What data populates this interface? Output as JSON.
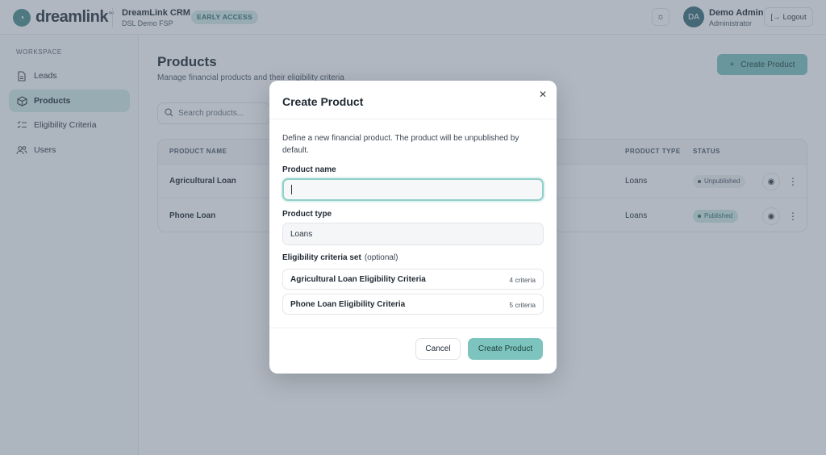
{
  "header": {
    "logo_text": "dreamlink",
    "logo_tm": "™",
    "app_name": "DreamLink CRM",
    "app_sub": "DSL Demo FSP",
    "badge": "EARLY ACCESS",
    "user_initials": "DA",
    "user_name": "Demo Admin",
    "user_role": "Administrator",
    "logout_label": "Logout"
  },
  "sidebar": {
    "section_label": "WORKSPACE",
    "items": [
      {
        "label": "Leads",
        "icon": "file-text-icon"
      },
      {
        "label": "Products",
        "icon": "box-icon",
        "active": true
      },
      {
        "label": "Eligibility Criteria",
        "icon": "checklist-icon"
      },
      {
        "label": "Users",
        "icon": "users-icon"
      }
    ]
  },
  "main": {
    "title": "Products",
    "subtitle": "Manage financial products and their eligibility criteria",
    "create_button": "Create Product",
    "search_placeholder": "Search products...",
    "columns": [
      "PRODUCT NAME",
      "PRODUCT TYPE",
      "STATUS"
    ],
    "rows": [
      {
        "name": "Agricultural Loan",
        "type": "Loans",
        "status": "Unpublished"
      },
      {
        "name": "Phone Loan",
        "type": "Loans",
        "status": "Published"
      }
    ]
  },
  "modal": {
    "title": "Create Product",
    "description": "Define a new financial product. The product will be unpublished by default.",
    "name_label": "Product name",
    "name_value": "",
    "type_label": "Product type",
    "type_value": "Loans",
    "criteria_label": "Eligibility criteria set",
    "criteria_optional": "(optional)",
    "criteria": [
      {
        "name": "Agricultural Loan Eligibility Criteria",
        "count": "4 criteria"
      },
      {
        "name": "Phone Loan Eligibility Criteria",
        "count": "5 criteria"
      }
    ],
    "cancel_label": "Cancel",
    "submit_label": "Create Product"
  },
  "colors": {
    "accent": "#7cc4bd",
    "brand": "#4d8f8c",
    "overlay": "#505f73"
  }
}
